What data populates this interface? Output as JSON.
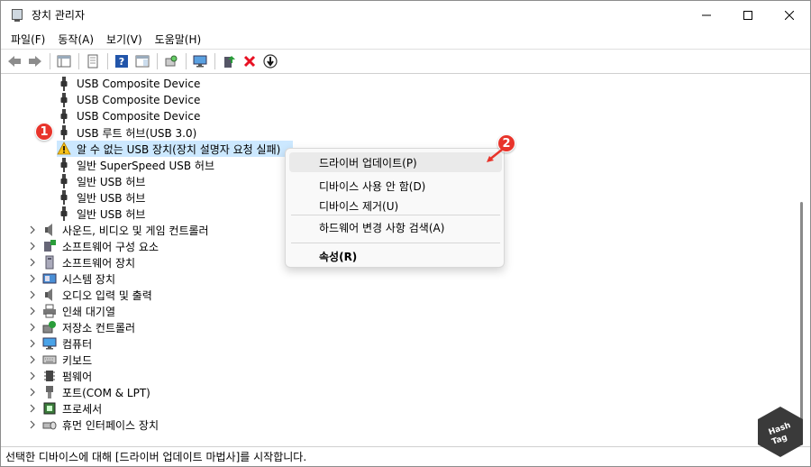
{
  "window": {
    "title": "장치 관리자"
  },
  "menu": [
    "파일(F)",
    "동작(A)",
    "보기(V)",
    "도움말(H)"
  ],
  "tree": {
    "usb_items": [
      "USB Composite Device",
      "USB Composite Device",
      "USB Composite Device",
      "USB 루트 허브(USB 3.0)",
      "알 수 없는 USB 장치(장치 설명자 요청 실패)",
      "일반 SuperSpeed USB 허브",
      "일반 USB 허브",
      "일반 USB 허브",
      "일반 USB 허브"
    ],
    "categories": [
      "사운드, 비디오 및 게임 컨트롤러",
      "소프트웨어 구성 요소",
      "소프트웨어 장치",
      "시스템 장치",
      "오디오 입력 및 출력",
      "인쇄 대기열",
      "저장소 컨트롤러",
      "컴퓨터",
      "키보드",
      "펌웨어",
      "포트(COM & LPT)",
      "프로세서",
      "휴먼 인터페이스 장치"
    ]
  },
  "context_menu": {
    "update_driver": "드라이버 업데이트(P)",
    "disable_device": "디바이스 사용 안 함(D)",
    "uninstall_device": "디바이스 제거(U)",
    "scan_hardware": "하드웨어 변경 사항 검색(A)",
    "properties": "속성(R)"
  },
  "badges": {
    "first": "1",
    "second": "2"
  },
  "status": "선택한 디바이스에 대해 [드라이버 업데이트 마법사]를 시작합니다.",
  "watermark": {
    "line1": "Hash",
    "line2": "Tag"
  },
  "colors": {
    "selection": "#cce8ff",
    "badge": "#e8342b",
    "error": "#e81123"
  }
}
